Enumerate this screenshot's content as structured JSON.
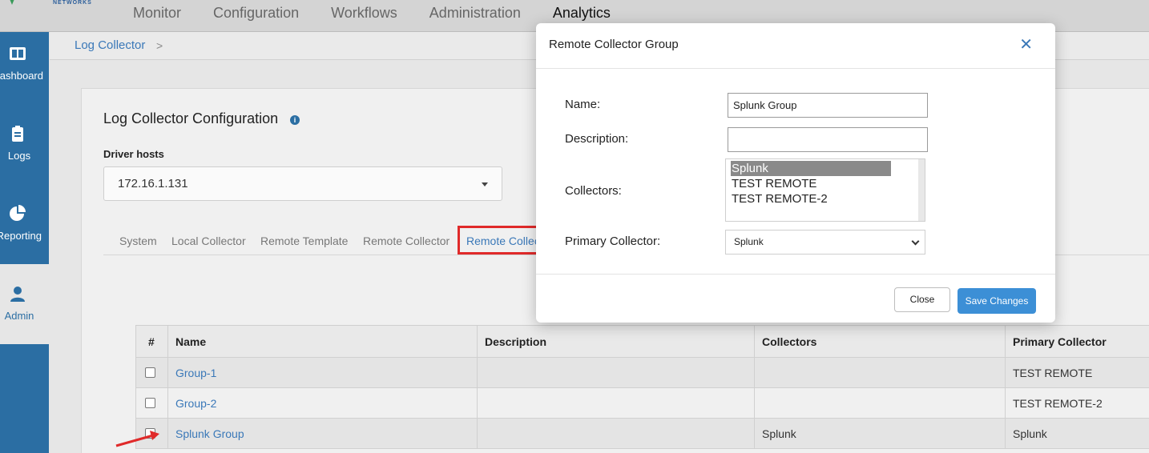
{
  "logo": {
    "sub_text": "NETWORKS"
  },
  "nav": [
    "Monitor",
    "Configuration",
    "Workflows",
    "Administration",
    "Analytics"
  ],
  "sidebar": [
    {
      "label": "Dashboard",
      "icon": "dashboard-icon"
    },
    {
      "label": "Logs",
      "icon": "clipboard-icon"
    },
    {
      "label": "Reporting",
      "icon": "pie-chart-icon"
    },
    {
      "label": "Admin",
      "icon": "user-icon",
      "active": true
    }
  ],
  "breadcrumb": {
    "item": "Log Collector",
    "separator": ">"
  },
  "page": {
    "title": "Log Collector Configuration",
    "driver_label": "Driver hosts",
    "driver_value": "172.16.1.131"
  },
  "tabs": [
    "System",
    "Local Collector",
    "Remote Template",
    "Remote Collector",
    "Remote Collec"
  ],
  "table": {
    "headers": [
      "#",
      "Name",
      "Description",
      "Collectors",
      "Primary Collector"
    ],
    "rows": [
      {
        "name": "Group-1",
        "description": "",
        "collectors": "",
        "primary": "TEST REMOTE"
      },
      {
        "name": "Group-2",
        "description": "",
        "collectors": "",
        "primary": "TEST REMOTE-2"
      },
      {
        "name": "Splunk Group",
        "description": "",
        "collectors": "Splunk",
        "primary": "Splunk"
      }
    ]
  },
  "modal": {
    "title": "Remote Collector Group",
    "name_label": "Name:",
    "name_value": "Splunk Group",
    "description_label": "Description:",
    "description_value": "",
    "collectors_label": "Collectors:",
    "collectors_options": [
      "Splunk",
      "TEST REMOTE",
      "TEST REMOTE-2"
    ],
    "collectors_selected": "Splunk",
    "primary_label": "Primary Collector:",
    "primary_value": "Splunk",
    "close_label": "Close",
    "save_label": "Save Changes"
  },
  "colors": {
    "accent": "#2b6ea3",
    "link": "#3a78b8",
    "highlight_box": "#e02a2a",
    "save_button": "#3c8fd6"
  }
}
